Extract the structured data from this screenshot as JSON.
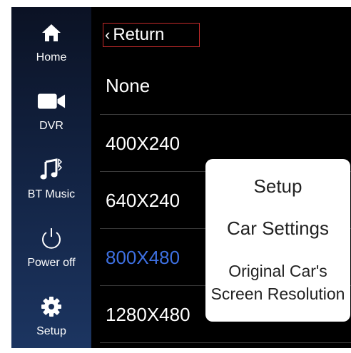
{
  "sidebar": {
    "items": [
      {
        "label": "Home",
        "icon": "home-icon"
      },
      {
        "label": "DVR",
        "icon": "camera-icon"
      },
      {
        "label": "BT Music",
        "icon": "bt-music-icon"
      },
      {
        "label": "Power off",
        "icon": "power-icon"
      },
      {
        "label": "Setup",
        "icon": "gear-icon"
      }
    ]
  },
  "header": {
    "return_label": "Return"
  },
  "resolutions": {
    "options": [
      "None",
      "400X240",
      "640X240",
      "800X480",
      "1280X480"
    ],
    "selected": "800X480"
  },
  "callout": {
    "line1": "Setup",
    "line2": "Car Settings",
    "line3a": "Original Car's",
    "line3b": "Screen Resolution"
  },
  "colors": {
    "selected": "#3d6fe0",
    "return_border": "#c12a2a",
    "sidebar_top": "#0b1224",
    "sidebar_bottom": "#1c3561"
  }
}
